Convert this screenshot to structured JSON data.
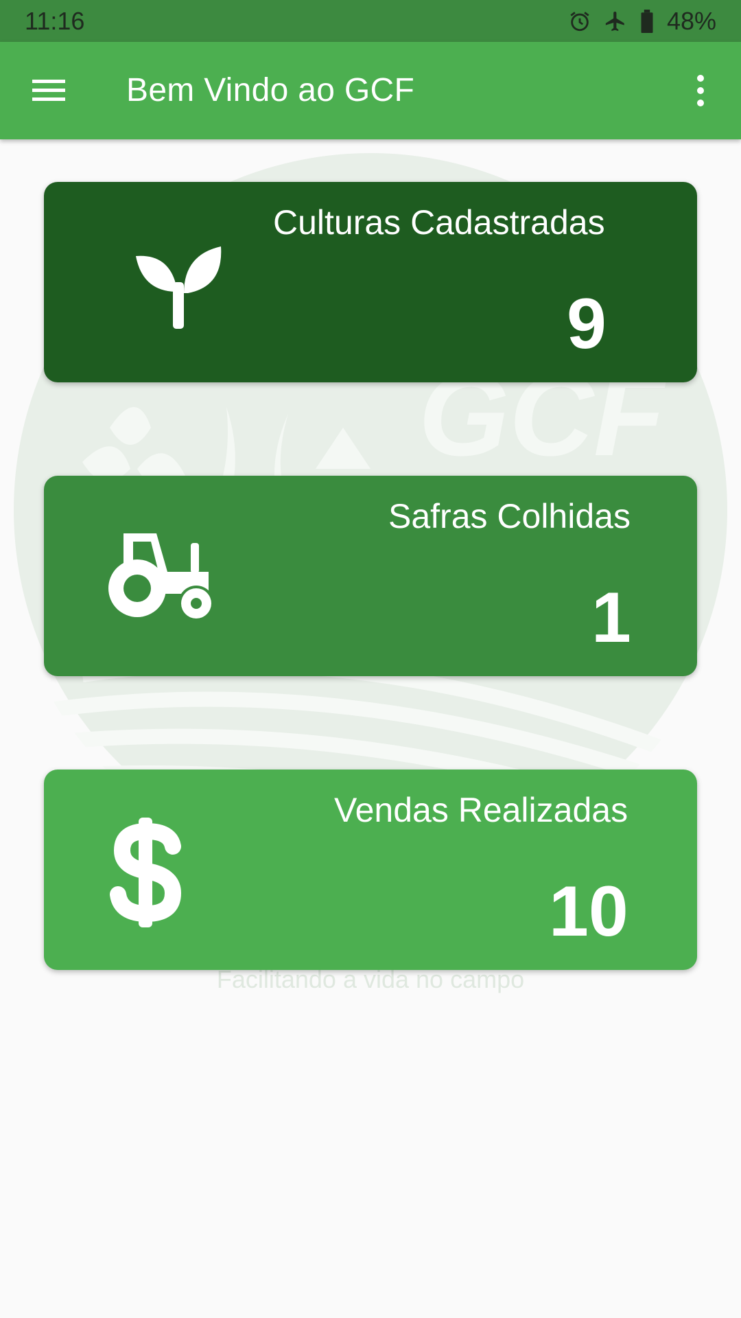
{
  "status_bar": {
    "time": "11:16",
    "battery": "48%",
    "icons": [
      "alarm-icon",
      "airplane-mode-icon",
      "battery-icon"
    ]
  },
  "app_bar": {
    "title": "Bem Vindo ao GCF",
    "left_icon": "hamburger-menu-icon",
    "right_icon": "overflow-menu-icon",
    "color": "#4caf50"
  },
  "background": {
    "logo_text": "GCF",
    "tagline": "Facilitando a vida no campo"
  },
  "cards": [
    {
      "label": "Culturas Cadastradas",
      "value": "9",
      "icon": "sprout-icon",
      "color": "#1e5c20"
    },
    {
      "label": "Safras Colhidas",
      "value": "1",
      "icon": "tractor-icon",
      "color": "#3a8c3e"
    },
    {
      "label": "Vendas Realizadas",
      "value": "10",
      "icon": "dollar-icon",
      "color": "#4caf50"
    }
  ]
}
